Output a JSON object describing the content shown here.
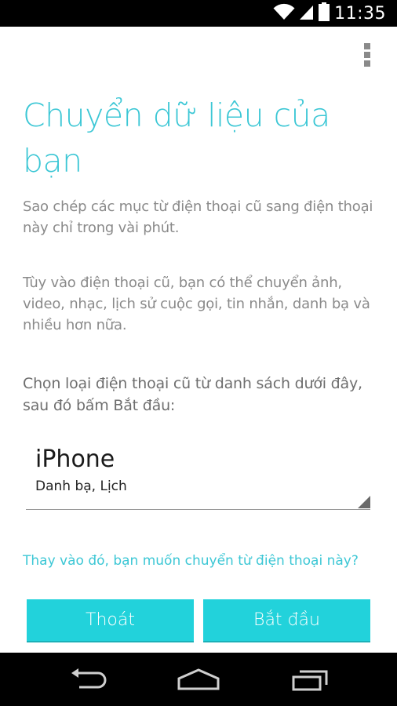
{
  "status_bar": {
    "time": "11:35",
    "icons": [
      "wifi-icon",
      "signal-icon",
      "battery-icon"
    ]
  },
  "menu": {
    "icon": "overflow-menu-icon"
  },
  "main": {
    "title": "Chuyển dữ liệu của bạn",
    "description_1": "Sao chép các mục từ điện thoại cũ sang điện thoại này chỉ trong vài phút.",
    "description_2": "Tùy vào điện thoại cũ, bạn có thể chuyển ảnh, video, nhạc, lịch sử cuộc gọi, tin nhắn, danh bạ và nhiều hơn nữa.",
    "instruction": "Chọn loại điện thoại cũ từ danh sách dưới đây, sau đó bấm Bắt đầu:",
    "device_selector": {
      "selected_name": "iPhone",
      "selected_description": "Danh bạ, Lịch"
    },
    "transfer_link": "Thay vào đó, bạn muốn chuyển từ điện thoại này?"
  },
  "buttons": {
    "exit_label": "Thoát",
    "start_label": "Bắt đầu"
  },
  "navigation": {
    "icons": [
      "back-icon",
      "home-icon",
      "recent-apps-icon"
    ]
  },
  "colors": {
    "accent": "#3cc7d5",
    "button": "#22d2db",
    "status_bar": "#000000"
  }
}
